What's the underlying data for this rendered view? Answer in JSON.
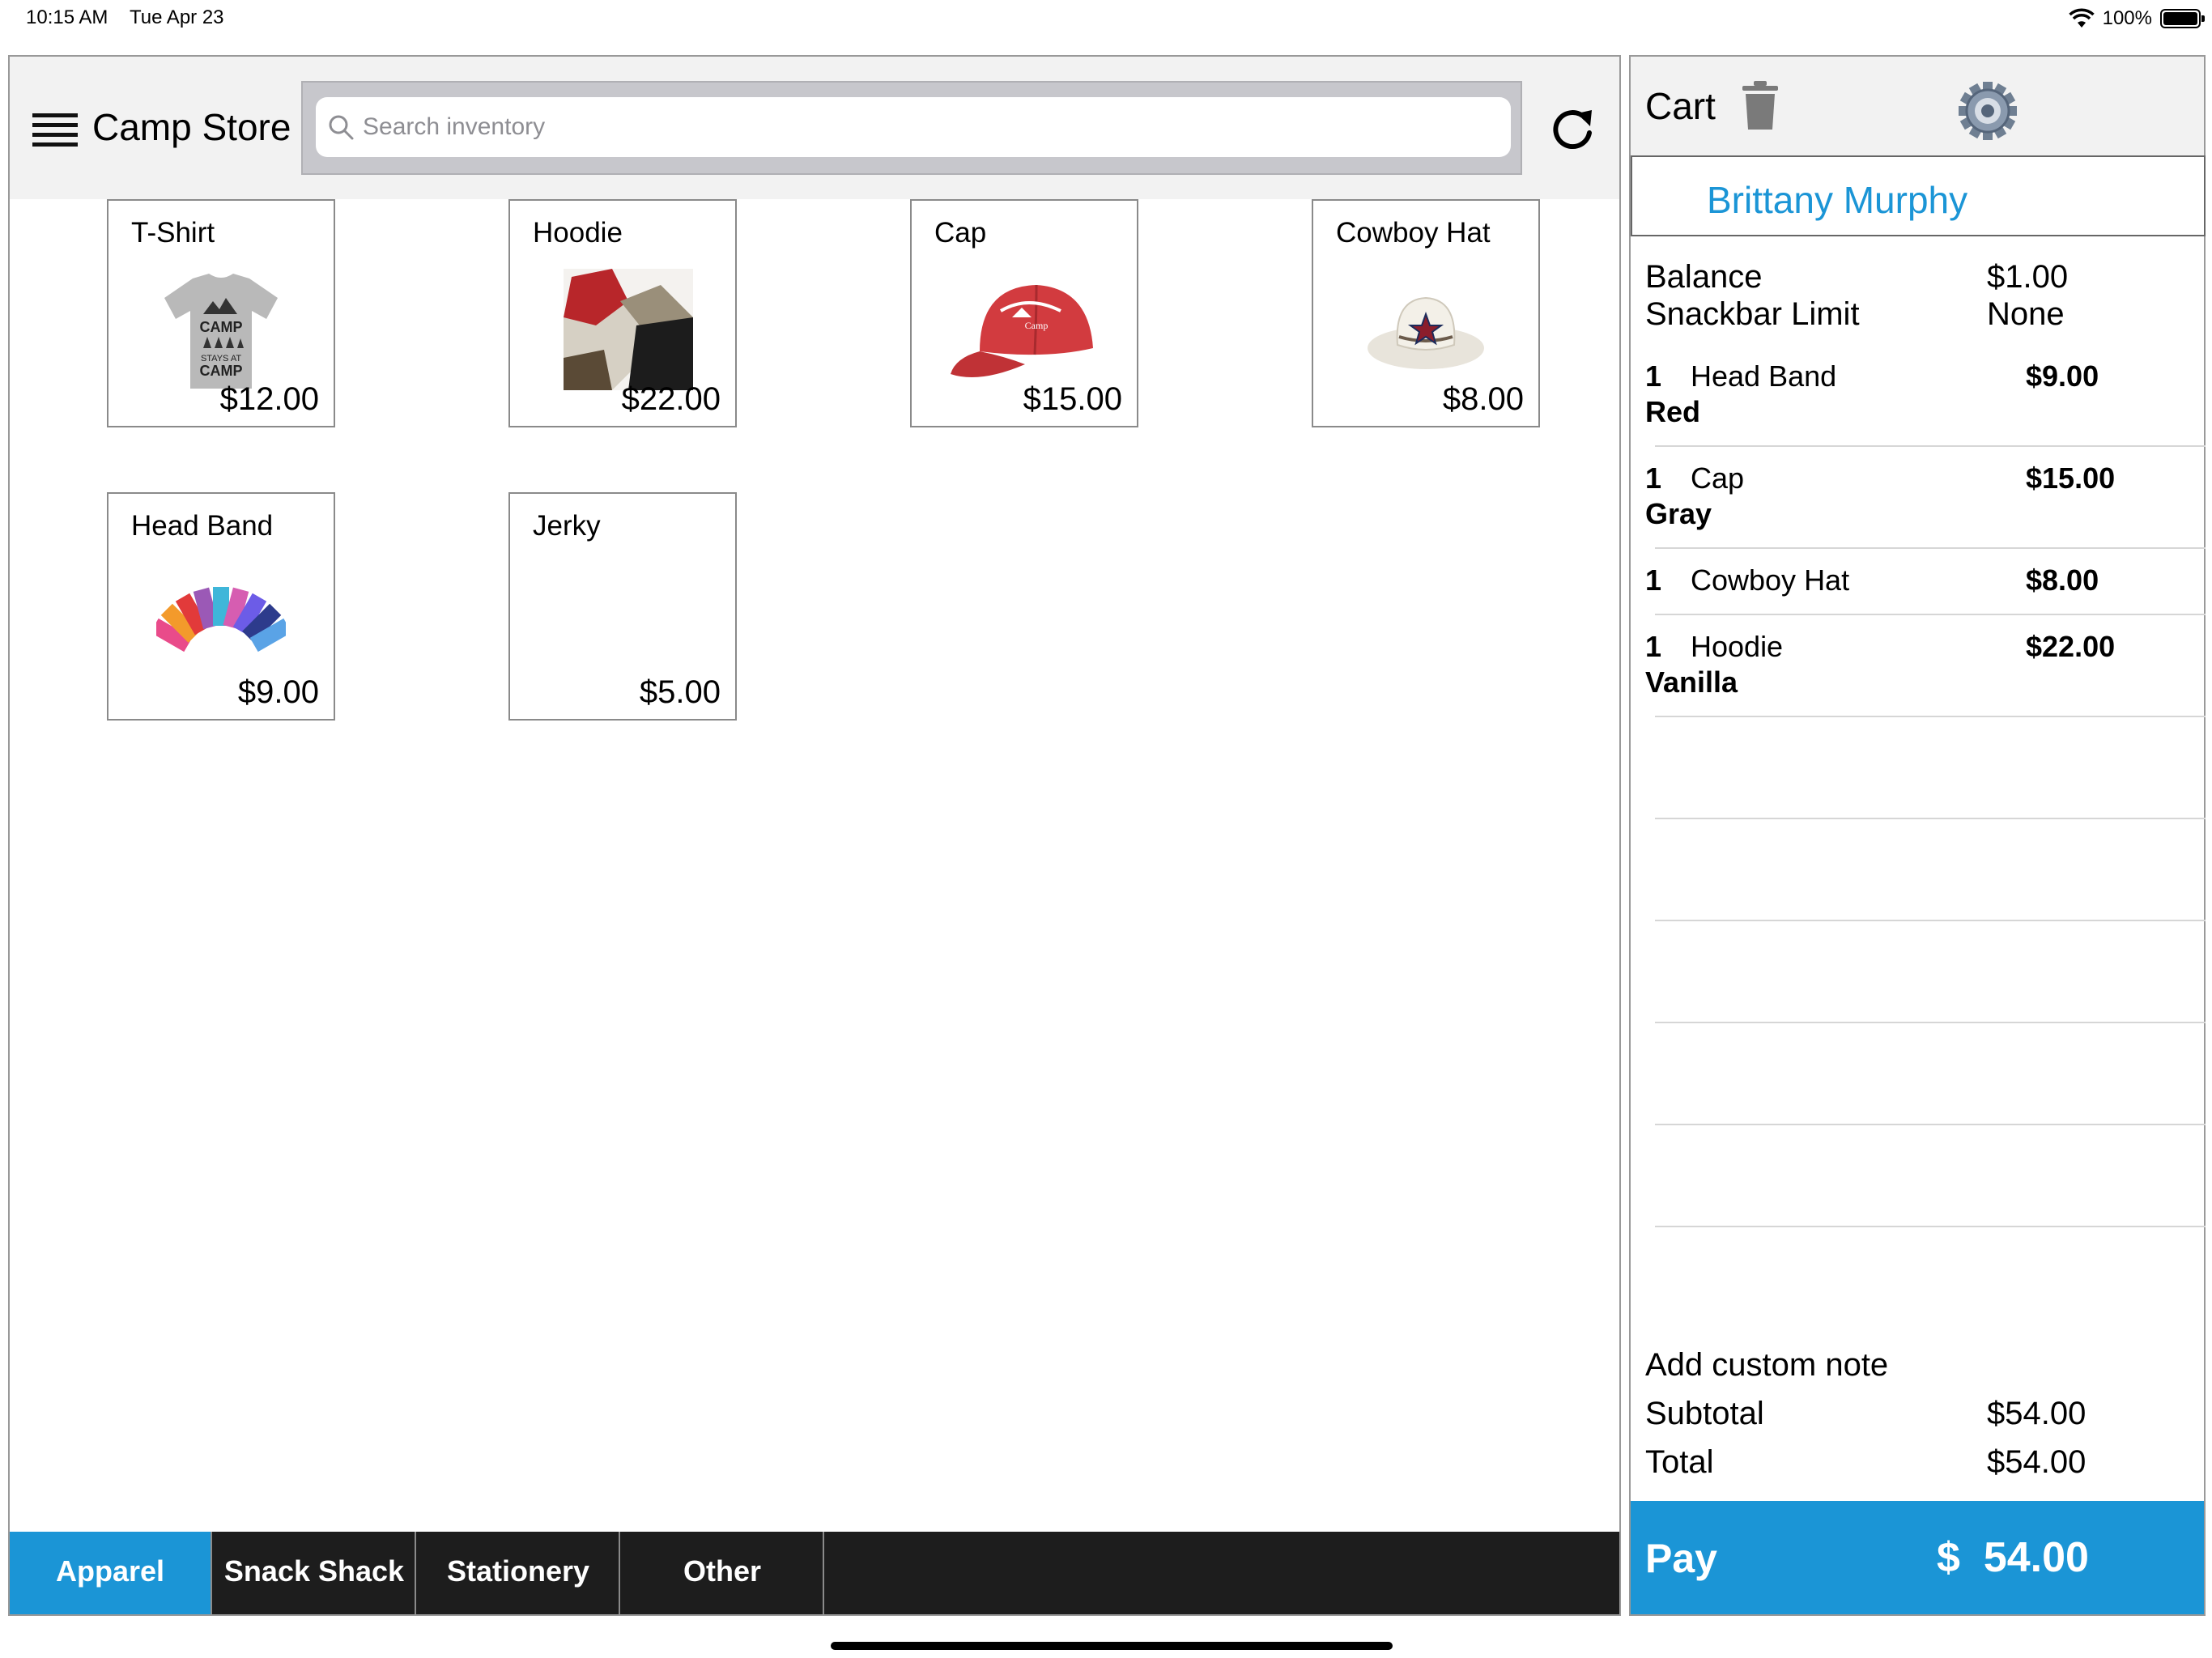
{
  "status_bar": {
    "time": "10:15 AM",
    "date": "Tue Apr 23",
    "battery": "100%"
  },
  "store": {
    "title": "Camp Store",
    "search_placeholder": "Search inventory",
    "products": [
      {
        "name": "T-Shirt",
        "price": "$12.00",
        "image": "tshirt-image"
      },
      {
        "name": "Hoodie",
        "price": "$22.00",
        "image": "hoodie-image"
      },
      {
        "name": "Cap",
        "price": "$15.00",
        "image": "cap-image"
      },
      {
        "name": "Cowboy Hat",
        "price": "$8.00",
        "image": "cowboy-hat-image"
      },
      {
        "name": "Head Band",
        "price": "$9.00",
        "image": "headband-image"
      },
      {
        "name": "Jerky",
        "price": "$5.00",
        "image": ""
      }
    ],
    "tshirt_print": "CAMP STAYS AT CAMP",
    "tabs": [
      {
        "label": "Apparel",
        "active": true
      },
      {
        "label": "Snack Shack",
        "active": false
      },
      {
        "label": "Stationery",
        "active": false
      },
      {
        "label": "Other",
        "active": false
      }
    ]
  },
  "cart": {
    "title": "Cart",
    "customer": "Brittany Murphy",
    "balance_label": "Balance",
    "balance_value": "$1.00",
    "limit_label": "Snackbar Limit",
    "limit_value": "None",
    "items": [
      {
        "qty": "1",
        "name": "Head Band",
        "price": "$9.00",
        "variant": "Red"
      },
      {
        "qty": "1",
        "name": "Cap",
        "price": "$15.00",
        "variant": "Gray"
      },
      {
        "qty": "1",
        "name": "Cowboy Hat",
        "price": "$8.00",
        "variant": ""
      },
      {
        "qty": "1",
        "name": "Hoodie",
        "price": "$22.00",
        "variant": "Vanilla"
      }
    ],
    "note_label": "Add custom note",
    "subtotal_label": "Subtotal",
    "subtotal_value": "$54.00",
    "total_label": "Total",
    "total_value": "$54.00",
    "pay_label": "Pay",
    "pay_currency": "$",
    "pay_amount": "54.00"
  },
  "colors": {
    "accent": "#1b95d6",
    "tabbar": "#1d1d1d",
    "header": "#f2f2f2"
  }
}
